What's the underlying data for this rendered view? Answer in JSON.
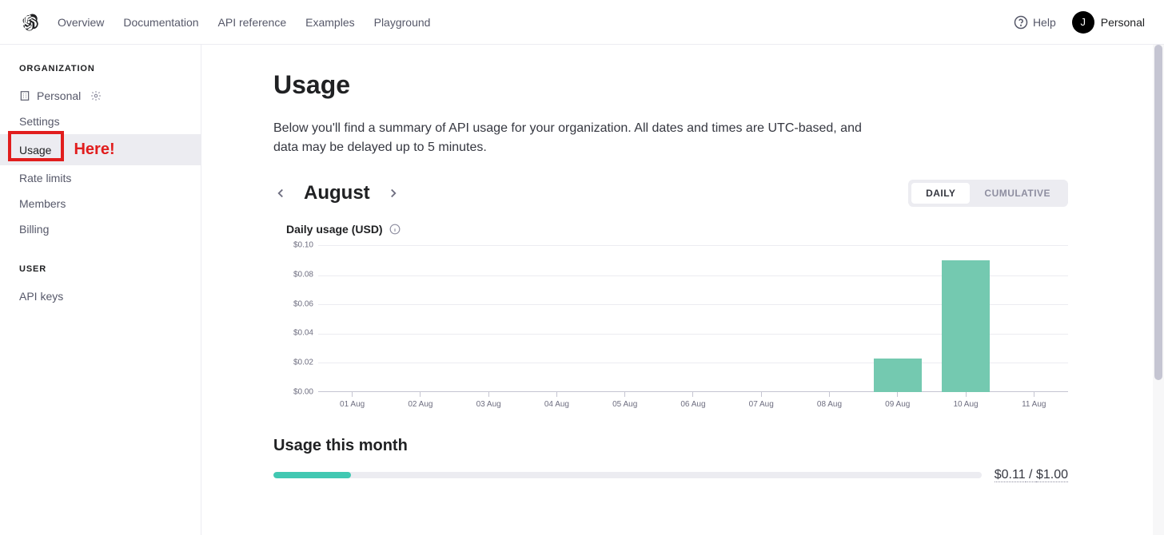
{
  "topnav": {
    "items": [
      "Overview",
      "Documentation",
      "API reference",
      "Examples",
      "Playground"
    ],
    "help": "Help",
    "account_initial": "J",
    "account_name": "Personal"
  },
  "sidebar": {
    "org_heading": "ORGANIZATION",
    "user_heading": "USER",
    "org_name": "Personal",
    "items": [
      "Settings",
      "Usage",
      "Rate limits",
      "Members",
      "Billing"
    ],
    "user_items": [
      "API keys"
    ],
    "annotation": "Here!"
  },
  "page": {
    "title": "Usage",
    "description": "Below you'll find a summary of API usage for your organization. All dates and times are UTC-based, and data may be delayed up to 5 minutes.",
    "month": "August",
    "toggle": {
      "daily": "DAILY",
      "cumulative": "CUMULATIVE"
    },
    "chart_title": "Daily usage (USD)",
    "usage_month_heading": "Usage this month",
    "progress": {
      "used": "$0.11",
      "sep": " / ",
      "limit": "$1.00",
      "percent": 11
    }
  },
  "chart_data": {
    "type": "bar",
    "title": "Daily usage (USD)",
    "xlabel": "",
    "ylabel": "",
    "ylim": [
      0,
      0.1
    ],
    "y_ticks": [
      "$0.10",
      "$0.08",
      "$0.06",
      "$0.04",
      "$0.02",
      "$0.00"
    ],
    "categories": [
      "01 Aug",
      "02 Aug",
      "03 Aug",
      "04 Aug",
      "05 Aug",
      "06 Aug",
      "07 Aug",
      "08 Aug",
      "09 Aug",
      "10 Aug",
      "11 Aug"
    ],
    "values": [
      0,
      0,
      0,
      0,
      0,
      0,
      0,
      0,
      0.023,
      0.09,
      0
    ]
  }
}
